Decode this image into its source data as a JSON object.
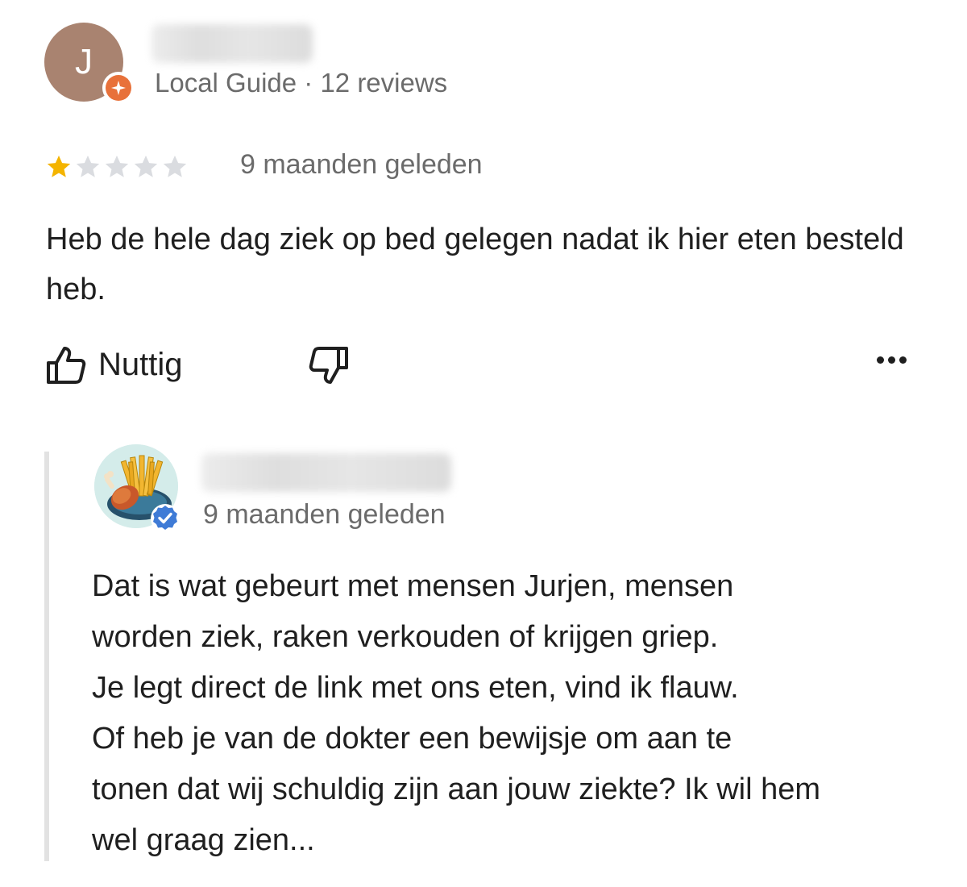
{
  "review": {
    "author": {
      "initial": "J",
      "name_blurred": "",
      "badge": "local-guide-star-icon",
      "meta": "Local Guide · 12 reviews"
    },
    "rating": {
      "stars": 1,
      "max": 5,
      "filled_color": "#f4b400",
      "empty_color": "#dadce0"
    },
    "date": "9 maanden geleden",
    "text": "Heb de hele dag ziek op bed gelegen nadat ik hier eten besteld heb.",
    "actions": {
      "helpful_label": "Nuttig",
      "helpful_icon": "thumbs-up-icon",
      "not_helpful_icon": "thumbs-down-icon",
      "more_icon": "more-options-icon"
    }
  },
  "reply": {
    "owner": {
      "name_blurred": "",
      "avatar": "fries-and-chicken-logo",
      "badge": "verified-check-icon"
    },
    "date": "9 maanden geleden",
    "lines": [
      "Dat is wat gebeurt met mensen Jurjen, mensen",
      "worden ziek, raken verkouden of krijgen griep.",
      "Je legt direct de link met ons eten, vind ik flauw.",
      "Of heb je van de dokter een bewijsje om aan te",
      "tonen dat wij schuldig zijn aan jouw ziekte? Ik wil hem",
      "wel graag zien..."
    ]
  },
  "colors": {
    "avatar_bg": "#a98370",
    "guide_badge": "#e8713a",
    "verified": "#3f7bd6",
    "reply_bar": "#e2e2e2"
  }
}
